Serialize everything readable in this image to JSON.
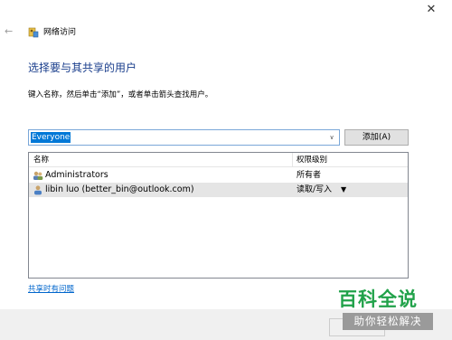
{
  "window": {
    "title": "网络访问",
    "close_glyph": "✕",
    "back_glyph": "←"
  },
  "main": {
    "heading": "选择要与其共享的用户",
    "instruction": "键入名称，然后单击“添加”，或者单击箭头查找用户。",
    "name_input": {
      "value": "Everyone",
      "dropdown_glyph": "∨"
    },
    "add_button": "添加(A)"
  },
  "user_list": {
    "columns": {
      "name": "名称",
      "permission": "权限级别"
    },
    "rows": [
      {
        "name": "Administrators",
        "permission": "所有者",
        "icon": "user-group-icon"
      },
      {
        "name": "libin luo (better_bin@outlook.com)",
        "permission": "读取/写入",
        "icon": "user-icon",
        "has_dropdown": true
      }
    ],
    "permission_dropdown_glyph": "▼"
  },
  "help_link": "共享时有问题",
  "watermark": {
    "top_text": "百科全说",
    "bottom_text": "助你轻松解决"
  },
  "colors": {
    "heading": "#1a3e8c",
    "link": "#0066cc",
    "selection": "#0078d7",
    "watermark_green": "#21a24a"
  }
}
